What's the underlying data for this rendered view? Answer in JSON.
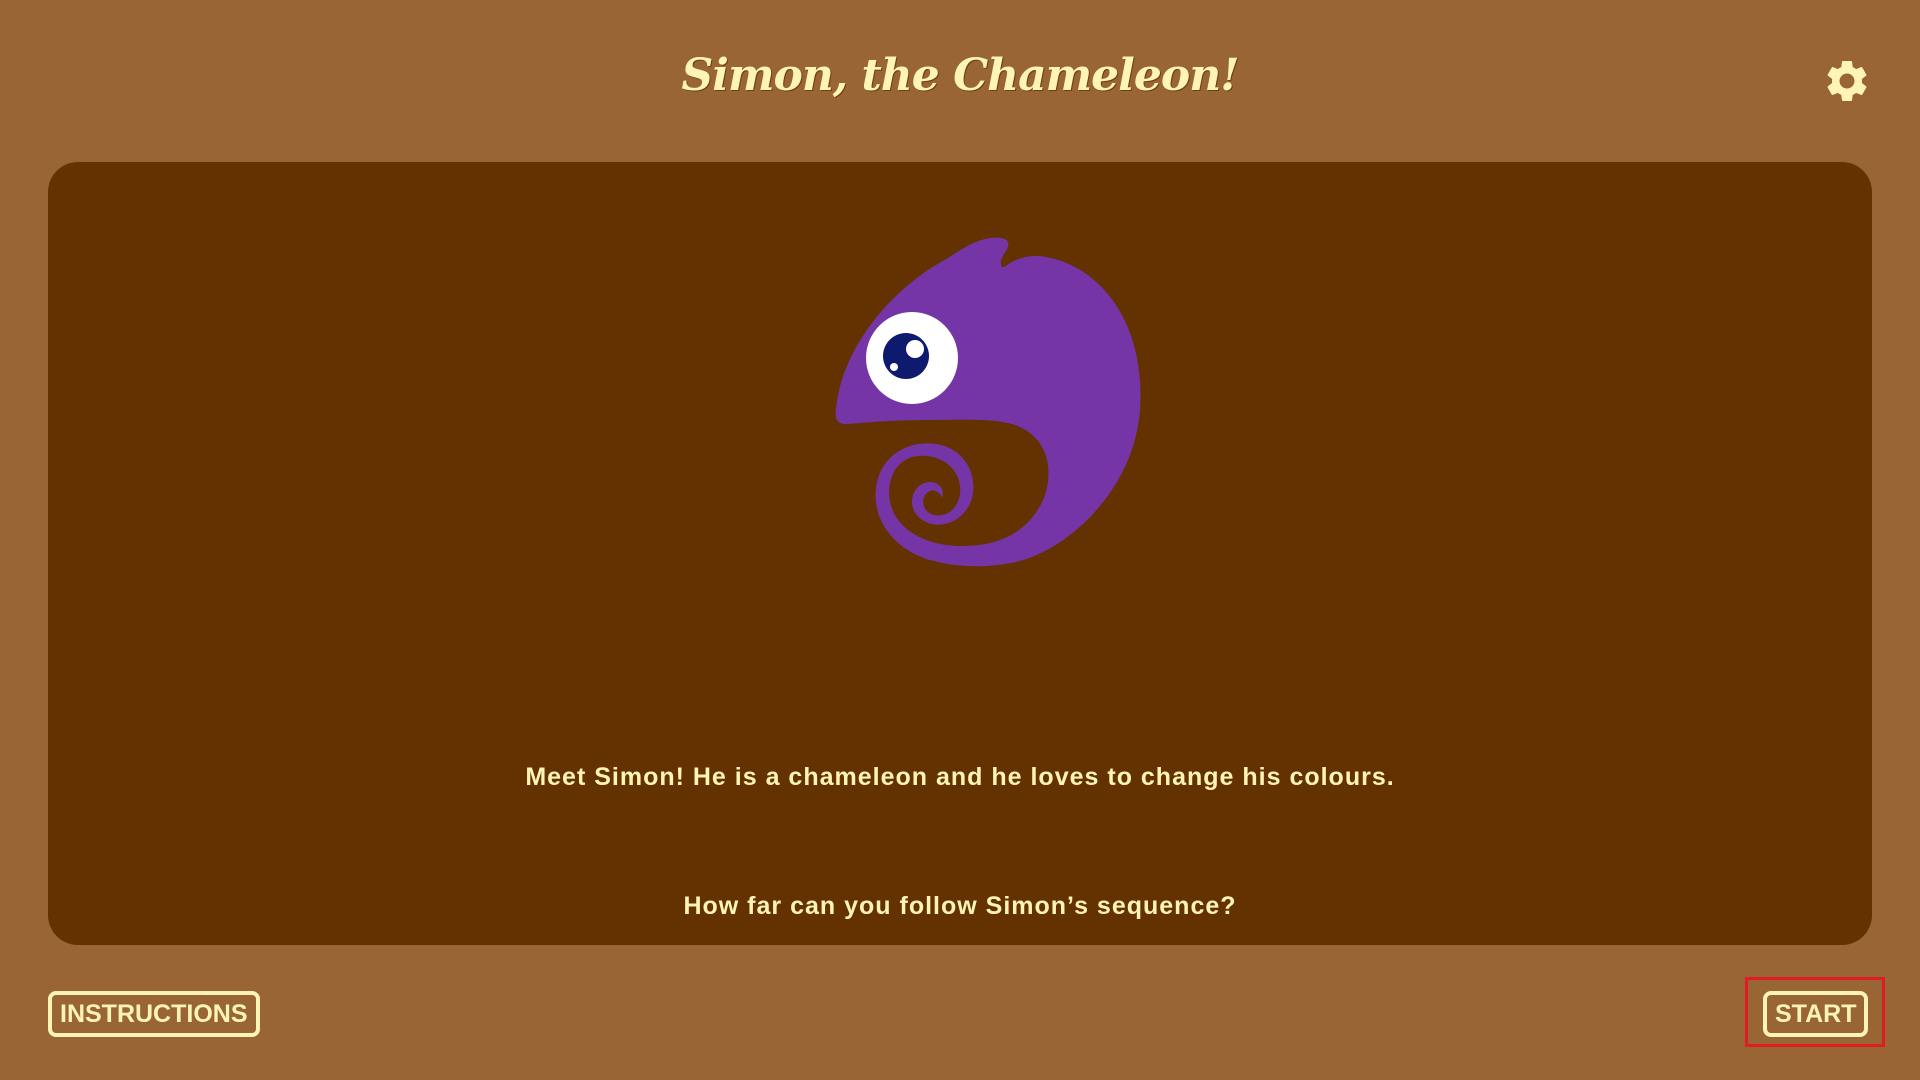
{
  "header": {
    "title": "Simon, the Chameleon!",
    "settings_icon": "gear-icon"
  },
  "stage": {
    "mascot_icon": "chameleon-icon",
    "intro_text": "Meet Simon! He is a chameleon and he loves to change his colours.",
    "question_text": "How far can you follow Simon’s sequence?"
  },
  "footer": {
    "instructions_label": "INSTRUCTIONS",
    "start_label": "START"
  },
  "colors": {
    "background": "#9a6534",
    "stage": "#643200",
    "text": "#fff4b8",
    "chameleon": "#7535a7",
    "eye_pupil": "#0d1a6e",
    "highlight": "#e01b24"
  }
}
